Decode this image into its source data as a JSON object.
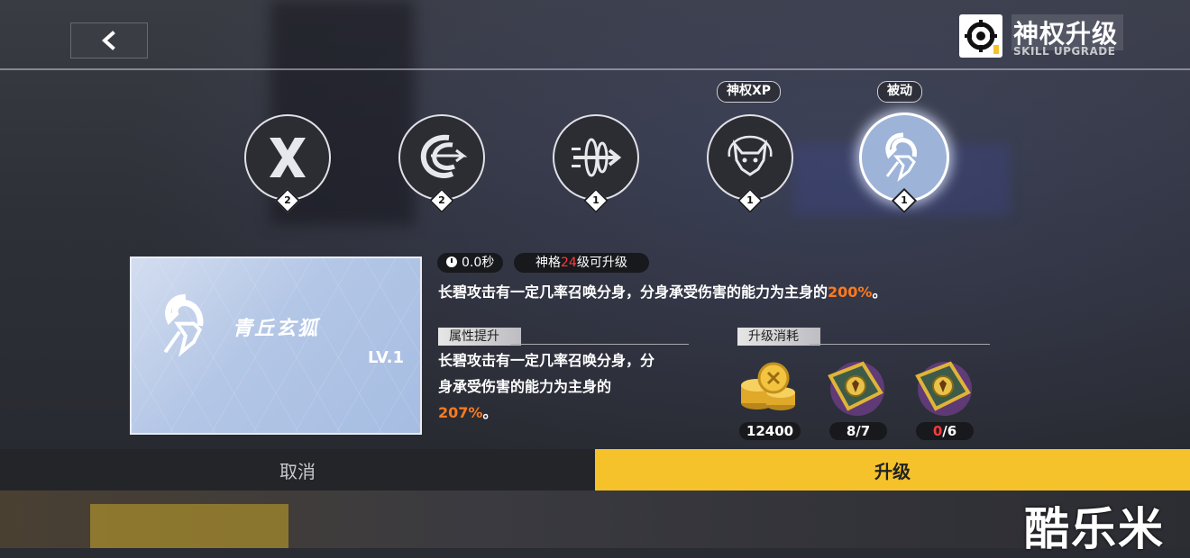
{
  "header": {
    "title_cn": "神权升级",
    "title_en": "SKILL UPGRADE"
  },
  "skills": [
    {
      "level": "2",
      "icon": "cross-blades-icon"
    },
    {
      "level": "2",
      "icon": "spiral-wind-icon"
    },
    {
      "level": "1",
      "icon": "dash-strike-icon"
    },
    {
      "level": "1",
      "icon": "fox-head-icon",
      "tag": "神权XP"
    },
    {
      "level": "1",
      "icon": "fox-spirit-icon",
      "tag": "被动",
      "active": true
    }
  ],
  "card": {
    "name": "青丘玄狐",
    "level": "LV.1"
  },
  "info": {
    "cooldown": "0.0秒",
    "req_prefix": "神格",
    "req_level": "24",
    "req_suffix": "级可升级",
    "desc_main": "长碧攻击有一定几率召唤分身，分身承受伤害的能力为主身的",
    "desc_value": "200%",
    "desc_end": "。"
  },
  "attr_section": {
    "header": "属性提升",
    "text_line1": "长碧攻击有一定几率召唤分身，分",
    "text_line2": "身承受伤害的能力为主身的",
    "value": "207%",
    "end": "。"
  },
  "cost_section": {
    "header": "升级消耗",
    "items": [
      {
        "icon": "gold-coins-icon",
        "amount": "12400"
      },
      {
        "icon": "skill-book-icon",
        "owned": "8",
        "required": "/7"
      },
      {
        "icon": "skill-book-icon",
        "owned": "0",
        "required": "/6"
      }
    ]
  },
  "buttons": {
    "cancel": "取消",
    "upgrade": "升级"
  },
  "watermark": "酷乐米",
  "colors": {
    "accent_yellow": "#f5c22b",
    "highlight_orange": "#ff7a1c",
    "warning_red": "#ff3a3a",
    "active_skill_blue": "#9db3d8"
  }
}
